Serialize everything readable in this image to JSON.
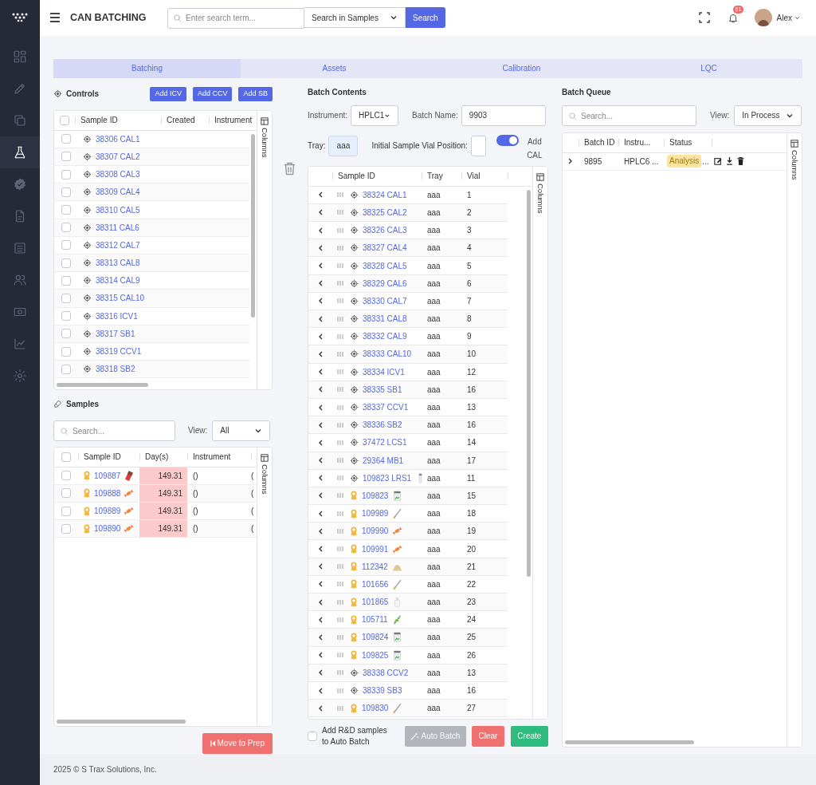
{
  "sidebar": {
    "items": [
      {
        "selected": false
      },
      {
        "selected": false
      },
      {
        "selected": false
      },
      {
        "selected": true
      },
      {
        "selected": false
      },
      {
        "selected": false
      },
      {
        "selected": false
      },
      {
        "selected": false
      },
      {
        "selected": false
      },
      {
        "selected": false
      },
      {
        "selected": false
      }
    ]
  },
  "header": {
    "title": "CAN BATCHING",
    "search": {
      "placeholder": "Enter search term..."
    },
    "scope": "Search in Samples",
    "search_button": "Search",
    "notifications": "61",
    "user": "Alex"
  },
  "tabs": [
    {
      "label": "Batching",
      "selected": true
    },
    {
      "label": "Assets",
      "selected": false
    },
    {
      "label": "Calibration",
      "selected": false
    },
    {
      "label": "LQC",
      "selected": false
    }
  ],
  "controls": {
    "title": "Controls",
    "buttons": [
      "Add ICV",
      "Add CCV",
      "Add SB"
    ],
    "columns": [
      "Sample ID",
      "Created",
      "Instrument"
    ],
    "side_tab": "Columns",
    "all_checked": false,
    "rows": [
      {
        "sample_id": "38306 CAL1",
        "checked": false
      },
      {
        "sample_id": "38307 CAL2",
        "checked": false
      },
      {
        "sample_id": "38308 CAL3",
        "checked": false
      },
      {
        "sample_id": "38309 CAL4",
        "checked": false
      },
      {
        "sample_id": "38310 CAL5",
        "checked": false
      },
      {
        "sample_id": "38311 CAL6",
        "checked": false
      },
      {
        "sample_id": "38312 CAL7",
        "checked": false
      },
      {
        "sample_id": "38313 CAL8",
        "checked": false
      },
      {
        "sample_id": "38314 CAL9",
        "checked": false
      },
      {
        "sample_id": "38315 CAL10",
        "checked": false
      },
      {
        "sample_id": "38316 ICV1",
        "checked": false
      },
      {
        "sample_id": "38317 SB1",
        "checked": false
      },
      {
        "sample_id": "38319 CCV1",
        "checked": false
      },
      {
        "sample_id": "38318 SB2",
        "checked": false
      }
    ]
  },
  "samples": {
    "title": "Samples",
    "search": {
      "placeholder": "Search..."
    },
    "view_label": "View:",
    "view": "All",
    "columns": [
      "Sample ID",
      "Day(s)",
      "Instrument"
    ],
    "side_tab": "Columns",
    "button": "Move to Prep",
    "all_checked": false,
    "rows": [
      {
        "sample_id": "109887",
        "product": {
          "kind": "bar"
        },
        "days": "149.31",
        "overdue": true,
        "instrument": "()",
        "column_4": "(",
        "checked": false
      },
      {
        "sample_id": "109888",
        "product": {
          "kind": "candy"
        },
        "days": "149.31",
        "overdue": true,
        "instrument": "()",
        "column_4": "(",
        "checked": false
      },
      {
        "sample_id": "109889",
        "product": {
          "kind": "candy"
        },
        "days": "149.31",
        "overdue": true,
        "instrument": "()",
        "column_4": "(",
        "checked": false
      },
      {
        "sample_id": "109890",
        "product": {
          "kind": "candy"
        },
        "days": "149.31",
        "overdue": true,
        "instrument": "()",
        "column_4": "(",
        "checked": false
      }
    ]
  },
  "batch_contents": {
    "title": "Batch Contents",
    "instrument_label": "Instrument:",
    "instrument": "HPLC1",
    "batch_name_label": "Batch Name:",
    "batch_name": "9903",
    "tray_label": "Tray:",
    "tray": "aaa",
    "vial_label": "Initial Sample Vial Position:",
    "toggle": {
      "label": "Add CAL",
      "on": true
    },
    "columns": [
      "Sample ID",
      "Tray",
      "Vial"
    ],
    "side_tab": "Columns",
    "rows": [
      {
        "kind": "control",
        "sample_id": "38324 CAL1",
        "tray": "aaa",
        "vial": "1"
      },
      {
        "kind": "control",
        "sample_id": "38325 CAL2",
        "tray": "aaa",
        "vial": "2"
      },
      {
        "kind": "control",
        "sample_id": "38326 CAL3",
        "tray": "aaa",
        "vial": "3"
      },
      {
        "kind": "control",
        "sample_id": "38327 CAL4",
        "tray": "aaa",
        "vial": "4"
      },
      {
        "kind": "control",
        "sample_id": "38328 CAL5",
        "tray": "aaa",
        "vial": "5"
      },
      {
        "kind": "control",
        "sample_id": "38329 CAL6",
        "tray": "aaa",
        "vial": "6"
      },
      {
        "kind": "control",
        "sample_id": "38330 CAL7",
        "tray": "aaa",
        "vial": "7"
      },
      {
        "kind": "control",
        "sample_id": "38331 CAL8",
        "tray": "aaa",
        "vial": "8"
      },
      {
        "kind": "control",
        "sample_id": "38332 CAL9",
        "tray": "aaa",
        "vial": "9"
      },
      {
        "kind": "control",
        "sample_id": "38333 CAL10",
        "tray": "aaa",
        "vial": "10"
      },
      {
        "kind": "control",
        "sample_id": "38334 ICV1",
        "tray": "aaa",
        "vial": "12"
      },
      {
        "kind": "control",
        "sample_id": "38335 SB1",
        "tray": "aaa",
        "vial": "16"
      },
      {
        "kind": "control",
        "sample_id": "38337 CCV1",
        "tray": "aaa",
        "vial": "13"
      },
      {
        "kind": "control",
        "sample_id": "38336 SB2",
        "tray": "aaa",
        "vial": "16"
      },
      {
        "kind": "control",
        "sample_id": "37472 LCS1",
        "tray": "aaa",
        "vial": "14"
      },
      {
        "kind": "control",
        "sample_id": "29364 MB1",
        "tray": "aaa",
        "vial": "17"
      },
      {
        "kind": "control",
        "sample_id": "109823 LRS1",
        "product": {
          "kind": "vial"
        },
        "tray": "aaa",
        "vial": "11"
      },
      {
        "kind": "sample",
        "sample_id": "109823",
        "product": {
          "kind": "jar"
        },
        "tray": "aaa",
        "vial": "15"
      },
      {
        "kind": "sample",
        "sample_id": "109989",
        "product": {
          "kind": "pen"
        },
        "tray": "aaa",
        "vial": "18"
      },
      {
        "kind": "sample",
        "sample_id": "109990",
        "product": {
          "kind": "candy"
        },
        "tray": "aaa",
        "vial": "19"
      },
      {
        "kind": "sample",
        "sample_id": "109991",
        "product": {
          "kind": "candy"
        },
        "tray": "aaa",
        "vial": "20"
      },
      {
        "kind": "sample",
        "sample_id": "112342",
        "product": {
          "kind": "powder"
        },
        "tray": "aaa",
        "vial": "21"
      },
      {
        "kind": "sample",
        "sample_id": "101656",
        "product": {
          "kind": "pen"
        },
        "tray": "aaa",
        "vial": "22"
      },
      {
        "kind": "sample",
        "sample_id": "101865",
        "product": {
          "kind": "bottle"
        },
        "tray": "aaa",
        "vial": "23"
      },
      {
        "kind": "sample",
        "sample_id": "105711",
        "product": {
          "kind": "herb"
        },
        "tray": "aaa",
        "vial": "24"
      },
      {
        "kind": "sample",
        "sample_id": "109824",
        "product": {
          "kind": "jar"
        },
        "tray": "aaa",
        "vial": "25"
      },
      {
        "kind": "sample",
        "sample_id": "109825",
        "product": {
          "kind": "jar"
        },
        "tray": "aaa",
        "vial": "26"
      },
      {
        "kind": "control",
        "sample_id": "38338 CCV2",
        "tray": "aaa",
        "vial": "13"
      },
      {
        "kind": "control",
        "sample_id": "38339 SB3",
        "tray": "aaa",
        "vial": "16"
      },
      {
        "kind": "sample",
        "sample_id": "109830",
        "product": {
          "kind": "pen"
        },
        "tray": "aaa",
        "vial": "27"
      }
    ],
    "rd_checkbox": {
      "label": "Add R&D samples to Auto Batch",
      "checked": false
    },
    "auto_batch": {
      "label": "Auto Batch",
      "disabled": true
    },
    "clear": "Clear",
    "create": "Create"
  },
  "batch_queue": {
    "title": "Batch Queue",
    "search": {
      "placeholder": "Search..."
    },
    "view_label": "View:",
    "view": "In Process",
    "columns": [
      "Batch ID",
      "Instru...",
      "Status"
    ],
    "side_tab": "Columns",
    "rows": [
      {
        "batch_id": "9895",
        "instrument": "HPLC6 ...",
        "status": "Analysis",
        "status_more": "..."
      }
    ]
  },
  "footer": "2025 © S Trax Solutions, Inc."
}
